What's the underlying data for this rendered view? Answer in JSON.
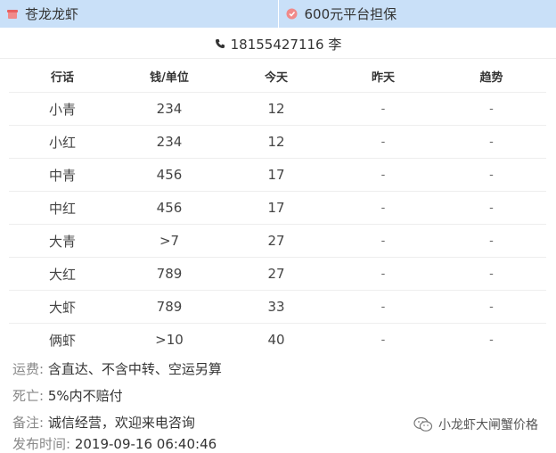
{
  "topbar": {
    "left_label": "苍龙龙虾",
    "right_label": "600元平台担保",
    "left_icon": "shop-icon",
    "right_icon": "shield-icon",
    "bg_color": "#c9e0f8"
  },
  "contact": {
    "icon": "phone-icon",
    "text": "18155427116 李"
  },
  "table": {
    "headers": [
      "行话",
      "钱/单位",
      "今天",
      "昨天",
      "趋势"
    ],
    "rows": [
      [
        "小青",
        "234",
        "12",
        "-",
        "-"
      ],
      [
        "小红",
        "234",
        "12",
        "-",
        "-"
      ],
      [
        "中青",
        "456",
        "17",
        "-",
        "-"
      ],
      [
        "中红",
        "456",
        "17",
        "-",
        "-"
      ],
      [
        "大青",
        ">7",
        "27",
        "-",
        "-"
      ],
      [
        "大红",
        "789",
        "27",
        "-",
        "-"
      ],
      [
        "大虾",
        "789",
        "33",
        "-",
        "-"
      ],
      [
        "俩虾",
        ">10",
        "40",
        "-",
        "-"
      ]
    ]
  },
  "info": {
    "shipping_label": "运费:",
    "shipping_value": "含直达、不含中转、空运另算",
    "death_label": "死亡:",
    "death_value": "5%内不赔付",
    "note_label": "备注:",
    "note_value": "诚信经营，欢迎来电咨询",
    "published_label": "发布时间:",
    "published_value": "2019-09-16 06:40:46"
  },
  "watermark": {
    "icon": "wechat-icon",
    "text": "小龙虾大闸蟹价格"
  }
}
